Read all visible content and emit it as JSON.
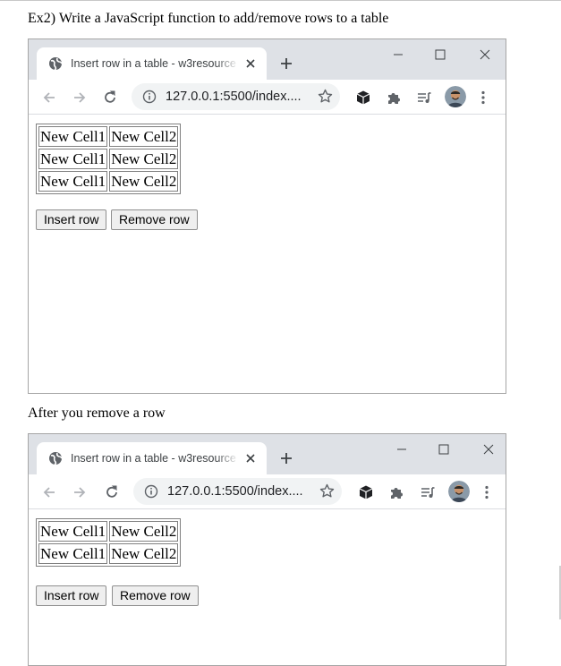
{
  "heading": "Ex2) Write a JavaScript function to add/remove rows to a table",
  "caption_after": "After you remove a row",
  "browser": {
    "tab_title": "Insert row in a table - w3resource",
    "url": "127.0.0.1:5500/index....",
    "icons": [
      "globe-icon",
      "close-icon",
      "plus-icon",
      "minimize-icon",
      "maximize-icon",
      "close-window-icon",
      "back-icon",
      "forward-icon",
      "reload-icon",
      "info-icon",
      "star-icon",
      "extension-cube-icon",
      "puzzle-icon",
      "reading-list-icon",
      "avatar",
      "menu-dots-icon"
    ]
  },
  "windows": [
    {
      "rows": [
        [
          "New Cell1",
          "New Cell2"
        ],
        [
          "New Cell1",
          "New Cell2"
        ],
        [
          "New Cell1",
          "New Cell2"
        ]
      ],
      "insert_label": "Insert row",
      "remove_label": "Remove row"
    },
    {
      "rows": [
        [
          "New Cell1",
          "New Cell2"
        ],
        [
          "New Cell1",
          "New Cell2"
        ]
      ],
      "insert_label": "Insert row",
      "remove_label": "Remove row"
    }
  ]
}
